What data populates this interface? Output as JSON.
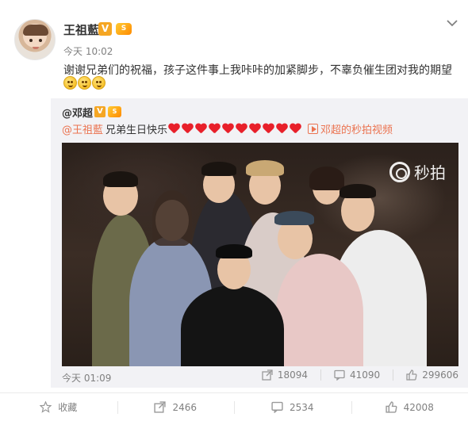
{
  "post": {
    "author": "王祖藍",
    "verified_badge": "V",
    "level_badge": "S",
    "time": "今天 10:02",
    "text": "谢谢兄弟们的祝福，孩子这件事上我咔咔的加紧脚步，不辜负催生团对我的期望",
    "emoji_count": 3
  },
  "repost": {
    "author": "@邓超",
    "verified_badge": "V",
    "level_badge": "S",
    "mention": "@王祖藍",
    "text": "兄弟生日快乐",
    "heart_count": 10,
    "video_link": "邓超的秒拍视频",
    "watermark": "秒拍",
    "time": "今天 01:09",
    "stats": {
      "share": "18094",
      "comment": "41090",
      "like": "299606"
    }
  },
  "actions": {
    "favorite": "收藏",
    "share": "2466",
    "comment": "2534",
    "like": "42008"
  },
  "icons": [
    "chevron-down-icon",
    "share-icon",
    "comment-icon",
    "thumbs-up-icon",
    "favorite-icon",
    "video-link-icon",
    "miaopai-logo-icon"
  ],
  "colors": {
    "accent": "#eb7350",
    "verified": "#f5a623",
    "repost_bg": "#f2f2f5",
    "muted": "#808080"
  }
}
